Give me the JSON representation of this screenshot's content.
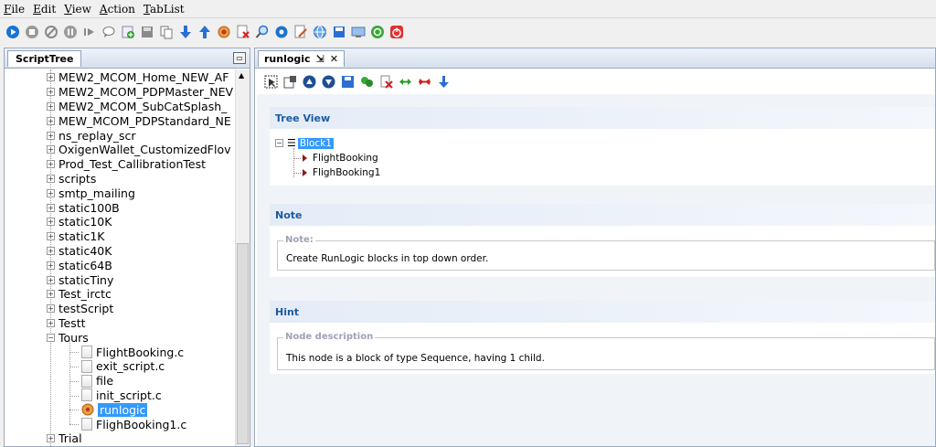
{
  "menu": [
    "File",
    "Edit",
    "View",
    "Action",
    "TabList"
  ],
  "toolbar_icons": [
    "play-icon",
    "stop-icon",
    "cancel-icon",
    "pause-icon",
    "step-icon",
    "comment-icon",
    "add-icon",
    "save-icon",
    "copy-icon",
    "download-icon",
    "upload-icon",
    "compile-icon",
    "report-icon",
    "search-icon",
    "settings-icon",
    "edit-icon",
    "globe-icon",
    "save-disk-icon",
    "screen-icon",
    "refresh-icon",
    "power-icon"
  ],
  "left_panel": {
    "tab_label": "ScriptTree",
    "items": [
      {
        "label": "MEW2_MCOM_Home_NEW_AF",
        "type": "folder"
      },
      {
        "label": "MEW2_MCOM_PDPMaster_NEV",
        "type": "folder"
      },
      {
        "label": "MEW2_MCOM_SubCatSplash_",
        "type": "folder"
      },
      {
        "label": "MEW_MCOM_PDPStandard_NE",
        "type": "folder"
      },
      {
        "label": "ns_replay_scr",
        "type": "folder"
      },
      {
        "label": "OxigenWallet_CustomizedFlov",
        "type": "folder"
      },
      {
        "label": "Prod_Test_CallibrationTest",
        "type": "folder"
      },
      {
        "label": "scripts",
        "type": "folder"
      },
      {
        "label": "smtp_mailing",
        "type": "folder"
      },
      {
        "label": "static100B",
        "type": "folder"
      },
      {
        "label": "static10K",
        "type": "folder"
      },
      {
        "label": "static1K",
        "type": "folder"
      },
      {
        "label": "static40K",
        "type": "folder"
      },
      {
        "label": "static64B",
        "type": "folder"
      },
      {
        "label": "staticTiny",
        "type": "folder"
      },
      {
        "label": "Test_irctc",
        "type": "folder"
      },
      {
        "label": "testScript",
        "type": "folder"
      },
      {
        "label": "Testt",
        "type": "folder"
      },
      {
        "label": "Tours",
        "type": "folder-open"
      },
      {
        "label": "FlightBooking.c",
        "type": "file"
      },
      {
        "label": "exit_script.c",
        "type": "file"
      },
      {
        "label": "file",
        "type": "file"
      },
      {
        "label": "init_script.c",
        "type": "file"
      },
      {
        "label": "runlogic",
        "type": "runlogic",
        "selected": true
      },
      {
        "label": "FlighBooking1.c",
        "type": "file"
      },
      {
        "label": "Trial",
        "type": "folder"
      }
    ]
  },
  "right_panel": {
    "tab_label": "runlogic",
    "tab_pin": "⇲",
    "tab_close": "✕",
    "sections": {
      "tree_view": {
        "title": "Tree View",
        "root": "Block1",
        "children": [
          "FlightBooking",
          "FlighBooking1"
        ]
      },
      "note": {
        "title": "Note",
        "legend": "Note:",
        "text": "Create RunLogic blocks in top down order."
      },
      "hint": {
        "title": "Hint",
        "legend": "Node description",
        "text": "This node is a block of type Sequence, having 1 child."
      }
    }
  }
}
